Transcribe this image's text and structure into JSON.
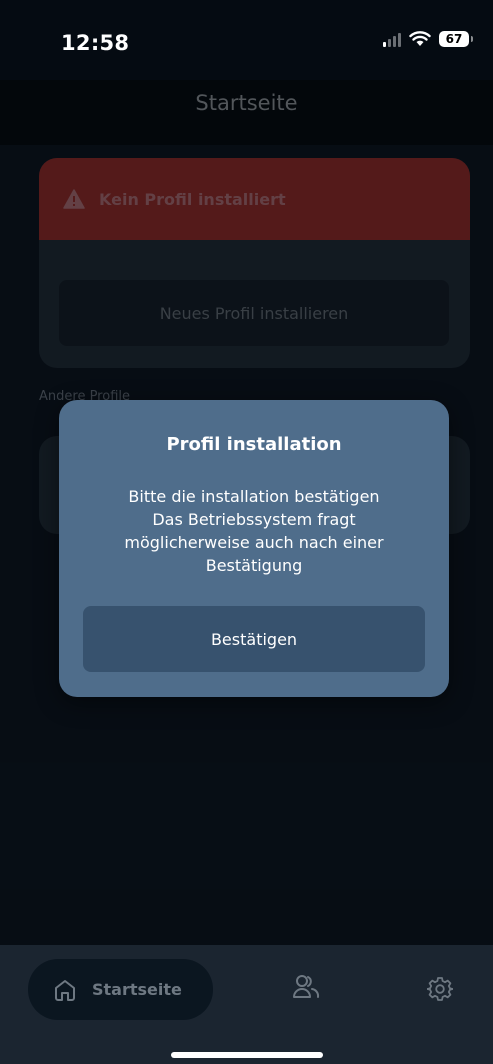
{
  "status_bar": {
    "time": "12:58",
    "battery_level": "67"
  },
  "header": {
    "title": "Startseite"
  },
  "main": {
    "alert_text": "Kein Profil installiert",
    "install_new_label": "Neues Profil installieren",
    "other_profiles_label": "Andere Profile"
  },
  "modal": {
    "title": "Profil installation",
    "message_lines": [
      "Bitte die installation bestätigen",
      "Das Betriebssystem fragt",
      "möglicherweise auch nach einer",
      "Bestätigung"
    ],
    "confirm_label": "Bestätigen"
  },
  "bottom_nav": {
    "home_label": "Startseite"
  },
  "icons": {
    "alert": "warning-triangle-icon",
    "home": "house-icon",
    "profiles": "users-icon",
    "settings": "gear-icon"
  },
  "colors": {
    "background": "#0b1520",
    "alert_red": "#812929",
    "modal_bg": "#4f6d8b",
    "confirm_button": "#37526e",
    "card_bg": "#1d2833"
  }
}
